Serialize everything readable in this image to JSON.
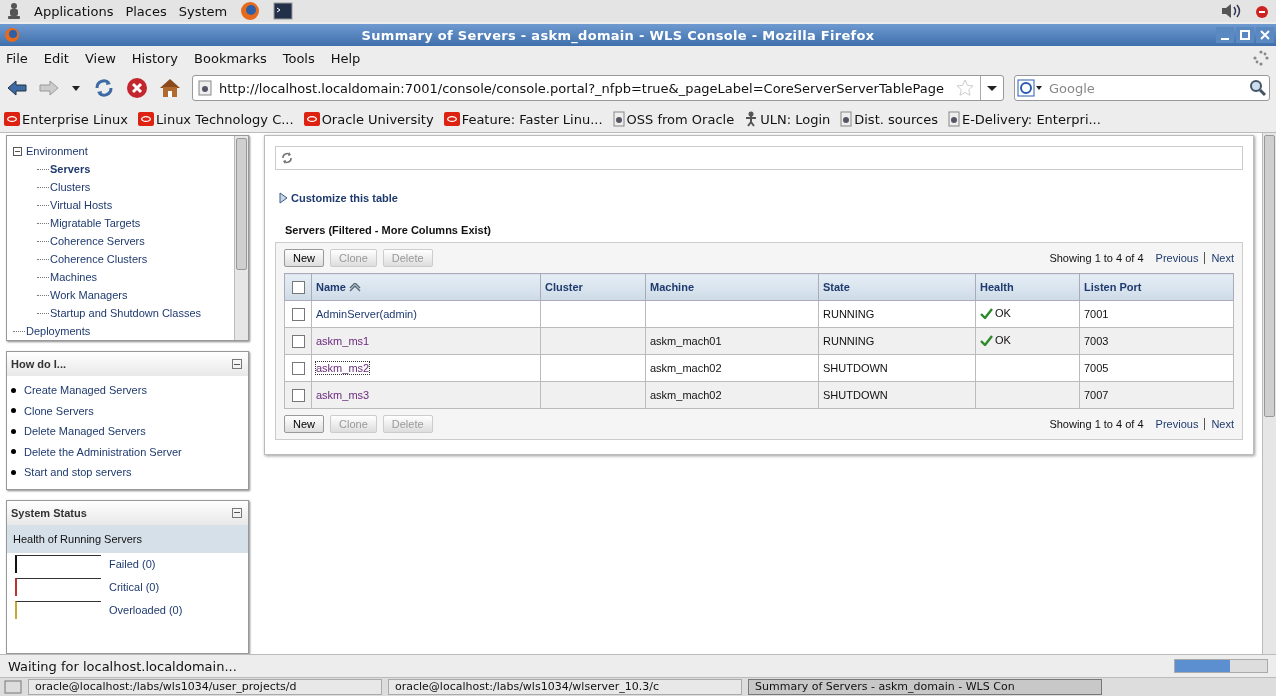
{
  "desktop_panel": {
    "menus": [
      "Applications",
      "Places",
      "System"
    ]
  },
  "window": {
    "title": "Summary of Servers - askm_domain - WLS Console - Mozilla Firefox"
  },
  "menu_bar": [
    "File",
    "Edit",
    "View",
    "History",
    "Bookmarks",
    "Tools",
    "Help"
  ],
  "address_bar": {
    "value": "http://localhost.localdomain:7001/console/console.portal?_nfpb=true&_pageLabel=CoreServerServerTablePage"
  },
  "search": {
    "placeholder": "Google"
  },
  "bookmarks": [
    {
      "label": "Enterprise Linux",
      "kind": "oracle"
    },
    {
      "label": "Linux Technology C...",
      "kind": "oracle"
    },
    {
      "label": "Oracle University",
      "kind": "oracle"
    },
    {
      "label": "Feature: Faster Linu...",
      "kind": "oracle"
    },
    {
      "label": "OSS from Oracle",
      "kind": "page"
    },
    {
      "label": "ULN: Login",
      "kind": "person"
    },
    {
      "label": "Dist. sources",
      "kind": "page"
    },
    {
      "label": "E-Delivery: Enterpri...",
      "kind": "page"
    }
  ],
  "domain_tree": {
    "items": [
      {
        "label": "Environment",
        "selected": false,
        "expanded": true,
        "children": [
          {
            "label": "Servers",
            "selected": true
          },
          {
            "label": "Clusters",
            "selected": false
          },
          {
            "label": "Virtual Hosts",
            "selected": false
          },
          {
            "label": "Migratable Targets",
            "selected": false
          },
          {
            "label": "Coherence Servers",
            "selected": false
          },
          {
            "label": "Coherence Clusters",
            "selected": false
          },
          {
            "label": "Machines",
            "selected": false
          },
          {
            "label": "Work Managers",
            "selected": false
          },
          {
            "label": "Startup and Shutdown Classes",
            "selected": false
          }
        ]
      },
      {
        "label": "Deployments",
        "selected": false
      }
    ]
  },
  "how_do_i": {
    "title": "How do I...",
    "links": [
      "Create Managed Servers",
      "Clone Servers",
      "Delete Managed Servers",
      "Delete the Administration Server",
      "Start and stop servers"
    ]
  },
  "system_status": {
    "title": "System Status",
    "subtitle": "Health of Running Servers",
    "levels": [
      {
        "label": "Failed (0)",
        "color": "#111111"
      },
      {
        "label": "Critical (0)",
        "color": "#c03030"
      },
      {
        "label": "Overloaded (0)",
        "color": "#c8a830"
      }
    ]
  },
  "customize_link": "Customize this table",
  "table": {
    "title": "Servers (Filtered - More Columns Exist)",
    "buttons_top": [
      {
        "label": "New",
        "disabled": false
      },
      {
        "label": "Clone",
        "disabled": true
      },
      {
        "label": "Delete",
        "disabled": true
      }
    ],
    "paging_top": {
      "summary": "Showing 1 to 4 of 4",
      "previous": "Previous",
      "next": "Next"
    },
    "select_all_checked": false,
    "columns": [
      {
        "label": "Name",
        "sorted": true
      },
      {
        "label": "Cluster",
        "sorted": false
      },
      {
        "label": "Machine",
        "sorted": false
      },
      {
        "label": "State",
        "sorted": false
      },
      {
        "label": "Health",
        "sorted": false
      },
      {
        "label": "Listen Port",
        "sorted": false
      }
    ],
    "rows": [
      {
        "checked": false,
        "name": "AdminServer(admin)",
        "visited": false,
        "focused": false,
        "state": "RUNNING",
        "health": "OK",
        "port": "7001"
      },
      {
        "checked": false,
        "name": "askm_ms1",
        "visited": true,
        "focused": false,
        "machine": "askm_mach01",
        "state": "RUNNING",
        "health": "OK",
        "port": "7003"
      },
      {
        "checked": false,
        "name": "askm_ms2",
        "visited": true,
        "focused": true,
        "machine": "askm_mach02",
        "state": "SHUTDOWN",
        "port": "7005"
      },
      {
        "checked": false,
        "name": "askm_ms3",
        "visited": true,
        "focused": false,
        "machine": "askm_mach02",
        "state": "SHUTDOWN",
        "port": "7007"
      }
    ],
    "buttons_bottom": [
      {
        "label": "New",
        "disabled": false
      },
      {
        "label": "Clone",
        "disabled": true
      },
      {
        "label": "Delete",
        "disabled": true
      }
    ],
    "paging_bottom": {
      "summary": "Showing 1 to 4 of 4",
      "previous": "Previous",
      "next": "Next"
    }
  },
  "status_bar": {
    "text": "Waiting for localhost.localdomain...",
    "level": 0.6
  },
  "taskbar": [
    {
      "label": "oracle@localhost:/labs/wls1034/user_projects/d",
      "selected": false
    },
    {
      "label": "oracle@localhost:/labs/wls1034/wlserver_10.3/c",
      "selected": false
    },
    {
      "label": "Summary of Servers - askm_domain - WLS Con",
      "selected": true
    }
  ]
}
